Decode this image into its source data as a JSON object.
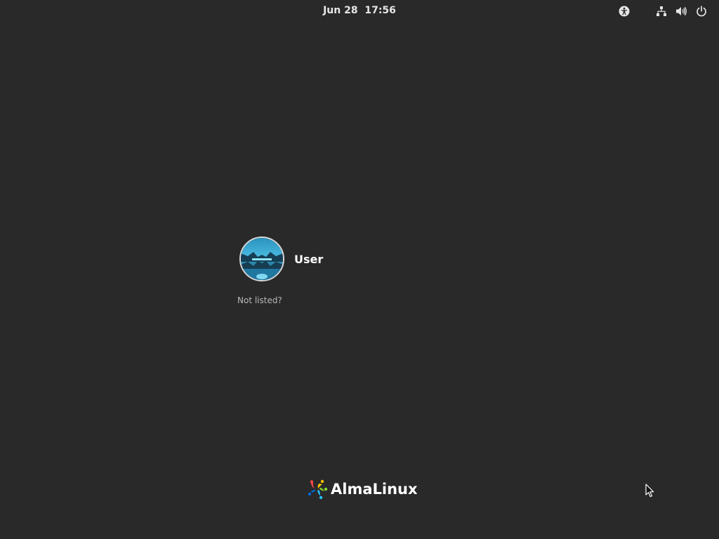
{
  "topbar": {
    "clock": "Jun 28  17:56",
    "icons": {
      "accessibility": "accessibility-icon",
      "network": "network-wired-icon",
      "volume": "volume-icon",
      "power": "power-icon"
    }
  },
  "users": [
    {
      "name": "User",
      "avatar": "avatar-icon"
    }
  ],
  "not_listed": "Not listed?",
  "brand": {
    "name": "AlmaLinux",
    "mark": "almalinux-logo-icon"
  },
  "colors": {
    "background": "#292929",
    "text": "#ffffff",
    "muted": "#b8b8b8",
    "avatar_border": "#d8d8d8"
  }
}
